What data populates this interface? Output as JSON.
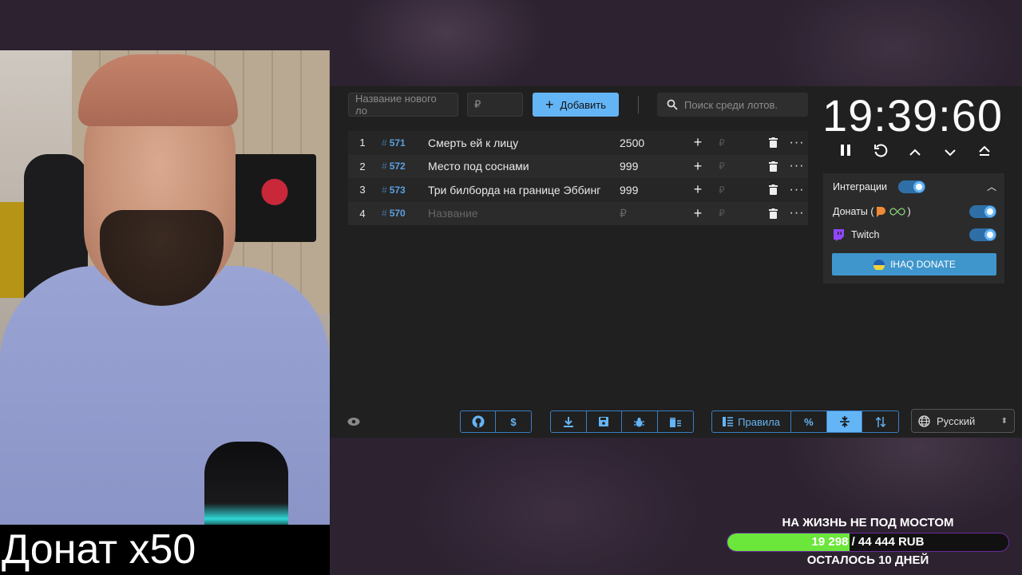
{
  "webcam": {
    "caption": "Донат x50"
  },
  "add_form": {
    "name_placeholder": "Название нового ло",
    "price_placeholder": "₽",
    "add_label": "Добавить",
    "search_placeholder": "Поиск среди лотов."
  },
  "lots": [
    {
      "index": "1",
      "id": "571",
      "title": "Смерть ей к лицу",
      "amount": "2500"
    },
    {
      "index": "2",
      "id": "572",
      "title": "Место под соснами",
      "amount": "999"
    },
    {
      "index": "3",
      "id": "573",
      "title": "Три билборда на границе Эббинг",
      "amount": "999"
    },
    {
      "index": "4",
      "id": "570",
      "title": "Название",
      "amount": "₽"
    }
  ],
  "lot_currency": "₽",
  "toolbar": {
    "rules_label": "Правила",
    "percent_label": "%",
    "language": "Русский"
  },
  "timer": {
    "time": "19:39:60"
  },
  "integrations": {
    "title": "Интеграции",
    "donations_label": "Донаты (",
    "donations_suffix": ")",
    "twitch_label": "Twitch",
    "ihaq_label": "IHAQ DONATE"
  },
  "goal": {
    "title": "НА ЖИЗНЬ НЕ ПОД МОСТОМ",
    "progress_text": "19 298 / 44 444 RUB",
    "current": 19298,
    "target": 44444,
    "remaining": "ОСТАЛОСЬ 10 ДНЕЙ",
    "fill_color": "#6be63b"
  },
  "colors": {
    "accent": "#64b5f6",
    "panel": "#202020"
  }
}
